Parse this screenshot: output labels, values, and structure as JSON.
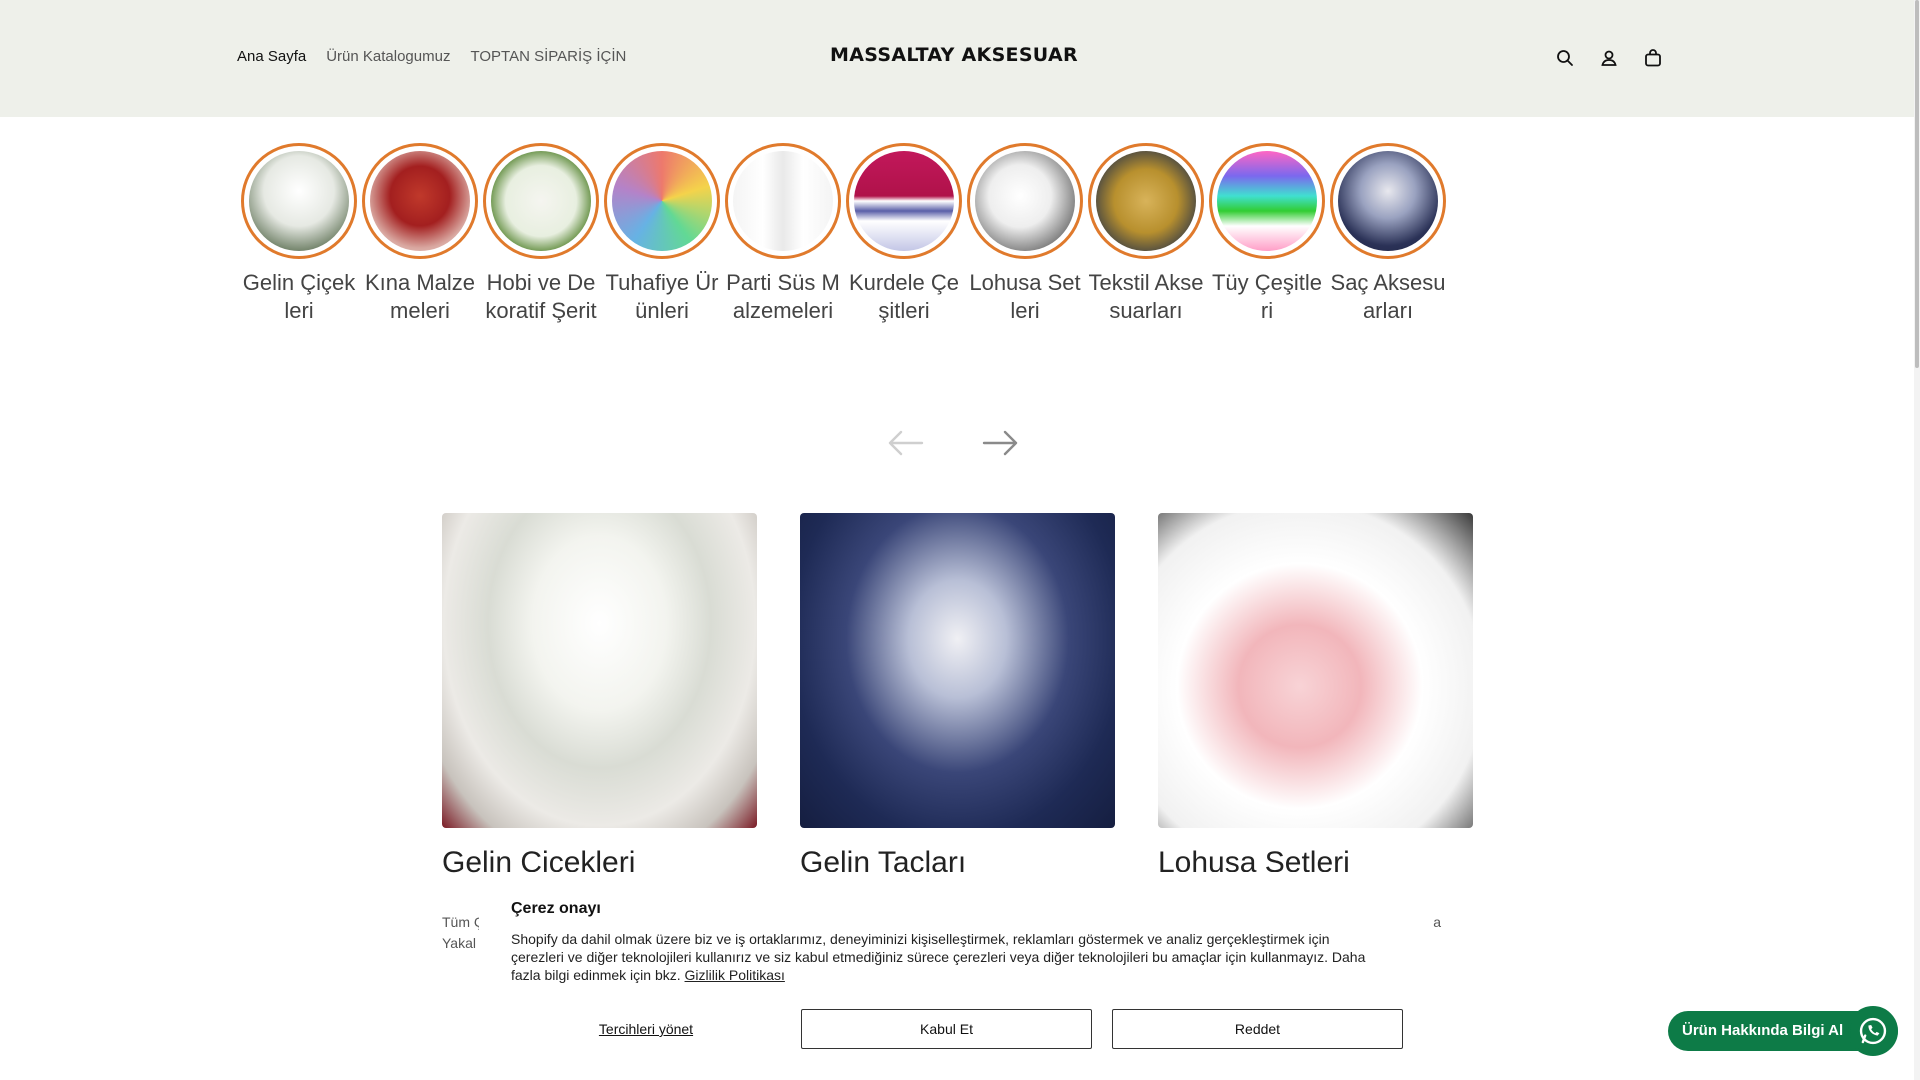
{
  "header": {
    "nav": [
      {
        "label": "Ana Sayfa"
      },
      {
        "label": "Ürün Katalogumuz"
      },
      {
        "label": "TOPTAN SİPARİŞ İÇİN"
      }
    ],
    "logo": "MASSALTAY AKSESUAR",
    "icons": [
      "search-icon",
      "account-icon",
      "cart-icon"
    ]
  },
  "categories": [
    {
      "label": "Gelin Çiçekleri"
    },
    {
      "label": "Kına Malzemeleri"
    },
    {
      "label": "Hobi ve Dekoratif Şerit"
    },
    {
      "label": "Tuhafiye Ürünleri"
    },
    {
      "label": "Parti Süs Malzemeleri"
    },
    {
      "label": "Kurdele Çeşitleri"
    },
    {
      "label": "Lohusa Setleri"
    },
    {
      "label": "Tekstil Aksesuarları"
    },
    {
      "label": "Tüy Çeşitleri"
    },
    {
      "label": "Saç Aksesuarları"
    }
  ],
  "carousel": {
    "prev_icon": "arrow-left-icon",
    "next_icon": "arrow-right-icon"
  },
  "collections": [
    {
      "title": "Gelin Çiçekleri",
      "desc_line1": "Tüm Ç",
      "desc_line2": "Yakal"
    },
    {
      "title": "Gelin Taçları",
      "desc_line1": "",
      "desc_line2": ""
    },
    {
      "title": "Lohusa Setleri",
      "desc_line1": "a",
      "desc_line2": ""
    }
  ],
  "cookie": {
    "title": "Çerez onayı",
    "text": "Shopify da dahil olmak üzere biz ve iş ortaklarımız, deneyiminizi kişiselleştirmek, reklamları göstermek ve analiz gerçekleştirmek için çerezleri ve diğer teknolojileri kullanırız ve siz kabul etmediğiniz sürece çerezleri veya diğer teknolojileri bu amaçlar için kullanmayız. Daha fazla bilgi edinmek için bkz.",
    "policy_link": "Gizlilik Politikası",
    "manage_label": "Tercihleri yönet",
    "accept_label": "Kabul Et",
    "reject_label": "Reddet"
  },
  "whatsapp": {
    "label": "Ürün Hakkında Bilgi Al",
    "icon": "whatsapp-icon"
  },
  "colors": {
    "header_bg": "#eef0ea",
    "ring": "#e07a2c",
    "whatsapp": "#0d7b47"
  }
}
